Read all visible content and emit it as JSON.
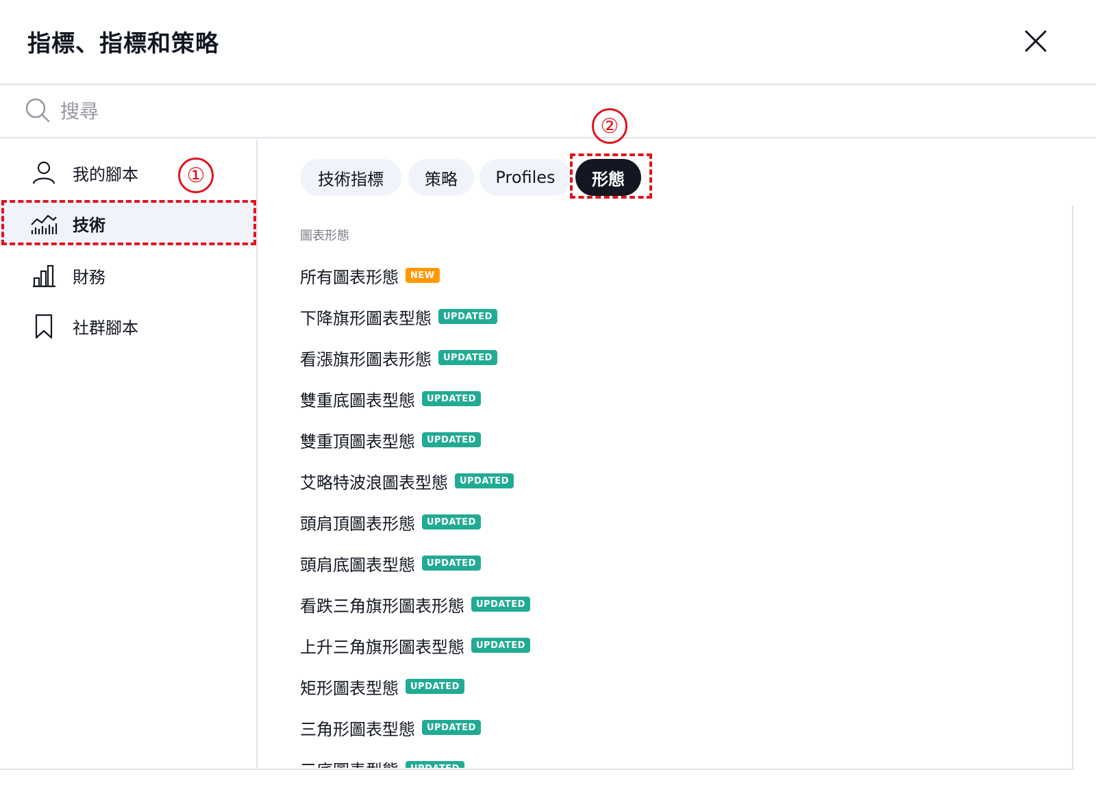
{
  "header": {
    "title": "指標、指標和策略"
  },
  "search": {
    "placeholder": "搜尋"
  },
  "sidebar": {
    "items": [
      {
        "label": "我的腳本",
        "icon": "user-icon"
      },
      {
        "label": "技術",
        "icon": "technicals-chart-icon",
        "active": true
      },
      {
        "label": "財務",
        "icon": "bar-chart-icon"
      },
      {
        "label": "社群腳本",
        "icon": "bookmark-icon"
      }
    ]
  },
  "tabs": [
    {
      "label": "技術指標"
    },
    {
      "label": "策略"
    },
    {
      "label": "Profiles"
    },
    {
      "label": "形態",
      "active": true
    }
  ],
  "section": {
    "title": "圖表形態"
  },
  "patterns": [
    {
      "label": "所有圖表形態",
      "badge": "NEW"
    },
    {
      "label": "下降旗形圖表型態",
      "badge": "UPDATED"
    },
    {
      "label": "看漲旗形圖表形態",
      "badge": "UPDATED"
    },
    {
      "label": "雙重底圖表型態",
      "badge": "UPDATED"
    },
    {
      "label": "雙重頂圖表型態",
      "badge": "UPDATED"
    },
    {
      "label": "艾略特波浪圖表型態",
      "badge": "UPDATED"
    },
    {
      "label": "頭肩頂圖表形態",
      "badge": "UPDATED"
    },
    {
      "label": "頭肩底圖表型態",
      "badge": "UPDATED"
    },
    {
      "label": "看跌三角旗形圖表形態",
      "badge": "UPDATED"
    },
    {
      "label": "上升三角旗形圖表型態",
      "badge": "UPDATED"
    },
    {
      "label": "矩形圖表型態",
      "badge": "UPDATED"
    },
    {
      "label": "三角形圖表型態",
      "badge": "UPDATED"
    },
    {
      "label": "三底圖表型態",
      "badge": "UPDATED"
    }
  ],
  "annotations": [
    {
      "label": "①"
    },
    {
      "label": "②"
    }
  ],
  "colors": {
    "new_badge": "#ff9800",
    "updated_badge": "#22ab94",
    "active_tab": "#131722",
    "annotation": "#e3121e"
  }
}
